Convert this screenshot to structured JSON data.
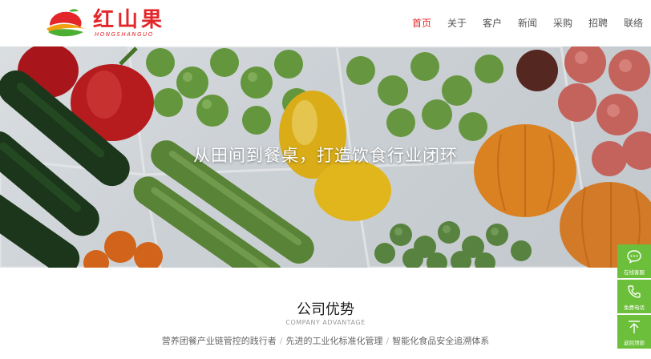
{
  "brand": {
    "name": "红山果",
    "subtitle": "HONGSHANGUO"
  },
  "nav": {
    "items": [
      {
        "label": "首页",
        "active": true
      },
      {
        "label": "关于",
        "active": false
      },
      {
        "label": "客户",
        "active": false
      },
      {
        "label": "新闻",
        "active": false
      },
      {
        "label": "采购",
        "active": false
      },
      {
        "label": "招聘",
        "active": false
      },
      {
        "label": "联络",
        "active": false
      }
    ]
  },
  "hero": {
    "slogan": "从田间到餐桌，打造饮食行业闭环"
  },
  "section": {
    "title": "公司优势",
    "subtitle": "COMPANY ADVANTAGE",
    "items": [
      "营养团餐产业链管控的践行者",
      "先进的工业化标准化管理",
      "智能化食品安全追溯体系"
    ]
  },
  "side_bar": {
    "buttons": [
      {
        "label": "在线客服",
        "icon": "chat-icon"
      },
      {
        "label": "免费电话",
        "icon": "phone-icon"
      },
      {
        "label": "返回顶部",
        "icon": "arrow-up-icon"
      }
    ]
  },
  "colors": {
    "brand_red": "#e2262a",
    "side_green": "#6cbf3a"
  }
}
